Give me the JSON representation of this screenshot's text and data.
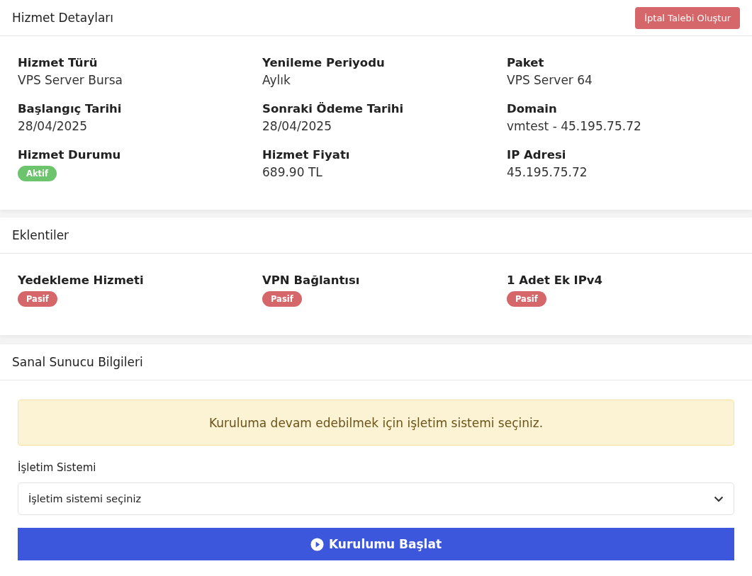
{
  "service_details": {
    "title": "Hizmet Detayları",
    "cancel_button": "İptal Talebi Oluştur",
    "fields": [
      {
        "label": "Hizmet Türü",
        "value": "VPS Server Bursa"
      },
      {
        "label": "Yenileme Periyodu",
        "value": "Aylık"
      },
      {
        "label": "Paket",
        "value": "VPS Server 64"
      },
      {
        "label": "Başlangıç Tarihi",
        "value": "28/04/2025"
      },
      {
        "label": "Sonraki Ödeme Tarihi",
        "value": "28/04/2025"
      },
      {
        "label": "Domain",
        "value": "vmtest - 45.195.75.72"
      },
      {
        "label": "Hizmet Durumu",
        "badge": "Aktif",
        "color": "#6cc56c"
      },
      {
        "label": "Hizmet Fiyatı",
        "value": "689.90 TL"
      },
      {
        "label": "IP Adresi",
        "value": "45.195.75.72"
      }
    ]
  },
  "addons": {
    "title": "Eklentiler",
    "items": [
      {
        "label": "Yedekleme Hizmeti",
        "badge": "Pasif",
        "color": "#d5676b"
      },
      {
        "label": "VPN Bağlantısı",
        "badge": "Pasif",
        "color": "#d5676b"
      },
      {
        "label": "1 Adet Ek IPv4",
        "badge": "Pasif",
        "color": "#d5676b"
      }
    ]
  },
  "virtual_server": {
    "title": "Sanal Sunucu Bilgileri",
    "alert": "Kuruluma devam edebilmek için işletim sistemi seçiniz.",
    "os_label": "İşletim Sistemi",
    "os_select": {
      "value": "İşletim sistemi seçiniz"
    },
    "start_button": "Kurulumu Başlat"
  }
}
